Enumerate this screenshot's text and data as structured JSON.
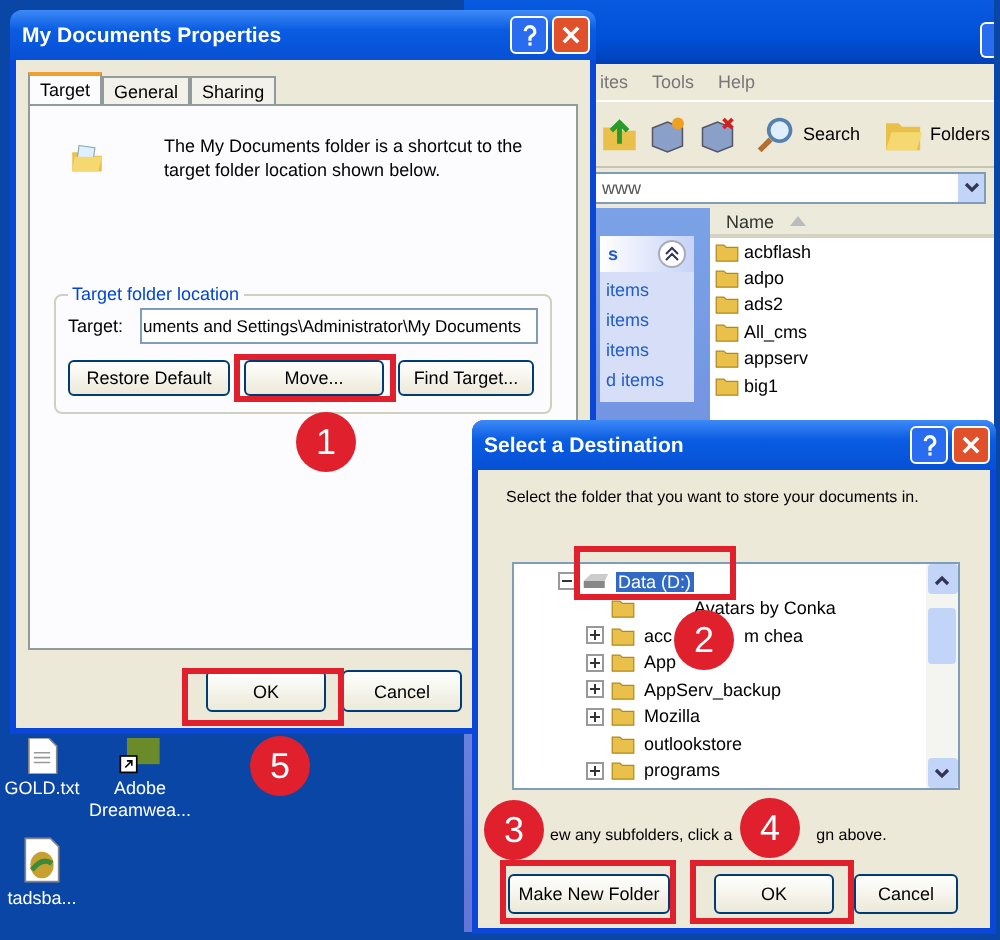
{
  "explorer": {
    "menu": [
      "ites",
      "Tools",
      "Help"
    ],
    "toolbar": [
      {
        "kind": "up"
      },
      {
        "kind": "new"
      },
      {
        "kind": "delete"
      },
      {
        "kind": "search",
        "label": "Search"
      },
      {
        "kind": "folders",
        "label": "Folders"
      }
    ],
    "address": "www",
    "task_pane": {
      "header": "s",
      "links": [
        "items",
        "items",
        "items",
        "d items"
      ]
    },
    "list": {
      "column": "Name",
      "rows": [
        "acbflash",
        "adpo",
        "ads2",
        "All_cms",
        "appserv",
        "big1"
      ]
    }
  },
  "properties": {
    "title": "My Documents Properties",
    "tabs": [
      {
        "label": "Target",
        "selected": true
      },
      {
        "label": "General",
        "selected": false
      },
      {
        "label": "Sharing",
        "selected": false
      }
    ],
    "description": "The My Documents folder is a shortcut to the target folder location shown below.",
    "group": {
      "title": "Target folder location",
      "field_label": "Target:",
      "value": "uments and Settings\\Administrator\\My Documents",
      "buttons": [
        "Restore Default",
        "Move...",
        "Find Target..."
      ]
    },
    "buttons": [
      "OK",
      "Cancel"
    ]
  },
  "destination": {
    "title": "Select a Destination",
    "instruction": "Select the folder that you want to store your documents in.",
    "tree": {
      "label": "Data (D:)",
      "selected": true,
      "expanded": true,
      "children": [
        {
          "parts": [
            "Avatars by Conka"
          ],
          "expandable": false
        },
        {
          "parts": [
            "acc",
            "m chea"
          ],
          "expandable": true
        },
        {
          "parts": [
            "App"
          ],
          "expandable": true
        },
        {
          "parts": [
            "AppServ_backup"
          ],
          "expandable": true
        },
        {
          "parts": [
            "Mozilla"
          ],
          "expandable": true
        },
        {
          "parts": [
            "outlookstore"
          ],
          "expandable": false
        },
        {
          "parts": [
            "programs"
          ],
          "expandable": true
        }
      ]
    },
    "hint_parts": [
      "ew any subfolders, click a",
      "gn above."
    ],
    "buttons": [
      "Make New Folder",
      "OK",
      "Cancel"
    ]
  },
  "desktop_icons": [
    {
      "kind": "text",
      "label": "GOLD.txt"
    },
    {
      "kind": "app",
      "label": "Adobe Dreamwea..."
    },
    {
      "kind": "image",
      "label": "tadsba..."
    }
  ],
  "annotations": [
    {
      "number": "1"
    },
    {
      "number": "2"
    },
    {
      "number": "3"
    },
    {
      "number": "4"
    },
    {
      "number": "5"
    }
  ]
}
